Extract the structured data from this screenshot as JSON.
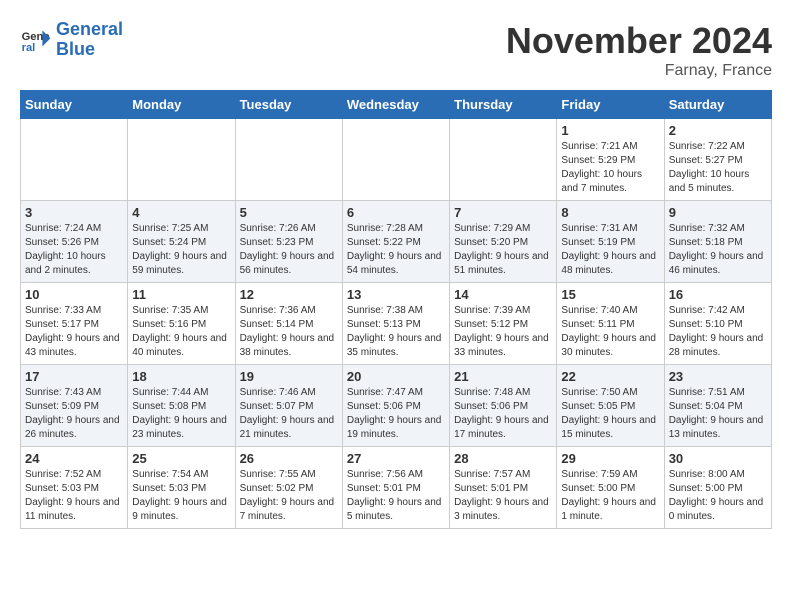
{
  "logo": {
    "line1": "General",
    "line2": "Blue"
  },
  "title": "November 2024",
  "location": "Farnay, France",
  "weekdays": [
    "Sunday",
    "Monday",
    "Tuesday",
    "Wednesday",
    "Thursday",
    "Friday",
    "Saturday"
  ],
  "weeks": [
    [
      {
        "day": "",
        "info": ""
      },
      {
        "day": "",
        "info": ""
      },
      {
        "day": "",
        "info": ""
      },
      {
        "day": "",
        "info": ""
      },
      {
        "day": "",
        "info": ""
      },
      {
        "day": "1",
        "info": "Sunrise: 7:21 AM\nSunset: 5:29 PM\nDaylight: 10 hours\nand 7 minutes."
      },
      {
        "day": "2",
        "info": "Sunrise: 7:22 AM\nSunset: 5:27 PM\nDaylight: 10 hours\nand 5 minutes."
      }
    ],
    [
      {
        "day": "3",
        "info": "Sunrise: 7:24 AM\nSunset: 5:26 PM\nDaylight: 10 hours\nand 2 minutes."
      },
      {
        "day": "4",
        "info": "Sunrise: 7:25 AM\nSunset: 5:24 PM\nDaylight: 9 hours\nand 59 minutes."
      },
      {
        "day": "5",
        "info": "Sunrise: 7:26 AM\nSunset: 5:23 PM\nDaylight: 9 hours\nand 56 minutes."
      },
      {
        "day": "6",
        "info": "Sunrise: 7:28 AM\nSunset: 5:22 PM\nDaylight: 9 hours\nand 54 minutes."
      },
      {
        "day": "7",
        "info": "Sunrise: 7:29 AM\nSunset: 5:20 PM\nDaylight: 9 hours\nand 51 minutes."
      },
      {
        "day": "8",
        "info": "Sunrise: 7:31 AM\nSunset: 5:19 PM\nDaylight: 9 hours\nand 48 minutes."
      },
      {
        "day": "9",
        "info": "Sunrise: 7:32 AM\nSunset: 5:18 PM\nDaylight: 9 hours\nand 46 minutes."
      }
    ],
    [
      {
        "day": "10",
        "info": "Sunrise: 7:33 AM\nSunset: 5:17 PM\nDaylight: 9 hours\nand 43 minutes."
      },
      {
        "day": "11",
        "info": "Sunrise: 7:35 AM\nSunset: 5:16 PM\nDaylight: 9 hours\nand 40 minutes."
      },
      {
        "day": "12",
        "info": "Sunrise: 7:36 AM\nSunset: 5:14 PM\nDaylight: 9 hours\nand 38 minutes."
      },
      {
        "day": "13",
        "info": "Sunrise: 7:38 AM\nSunset: 5:13 PM\nDaylight: 9 hours\nand 35 minutes."
      },
      {
        "day": "14",
        "info": "Sunrise: 7:39 AM\nSunset: 5:12 PM\nDaylight: 9 hours\nand 33 minutes."
      },
      {
        "day": "15",
        "info": "Sunrise: 7:40 AM\nSunset: 5:11 PM\nDaylight: 9 hours\nand 30 minutes."
      },
      {
        "day": "16",
        "info": "Sunrise: 7:42 AM\nSunset: 5:10 PM\nDaylight: 9 hours\nand 28 minutes."
      }
    ],
    [
      {
        "day": "17",
        "info": "Sunrise: 7:43 AM\nSunset: 5:09 PM\nDaylight: 9 hours\nand 26 minutes."
      },
      {
        "day": "18",
        "info": "Sunrise: 7:44 AM\nSunset: 5:08 PM\nDaylight: 9 hours\nand 23 minutes."
      },
      {
        "day": "19",
        "info": "Sunrise: 7:46 AM\nSunset: 5:07 PM\nDaylight: 9 hours\nand 21 minutes."
      },
      {
        "day": "20",
        "info": "Sunrise: 7:47 AM\nSunset: 5:06 PM\nDaylight: 9 hours\nand 19 minutes."
      },
      {
        "day": "21",
        "info": "Sunrise: 7:48 AM\nSunset: 5:06 PM\nDaylight: 9 hours\nand 17 minutes."
      },
      {
        "day": "22",
        "info": "Sunrise: 7:50 AM\nSunset: 5:05 PM\nDaylight: 9 hours\nand 15 minutes."
      },
      {
        "day": "23",
        "info": "Sunrise: 7:51 AM\nSunset: 5:04 PM\nDaylight: 9 hours\nand 13 minutes."
      }
    ],
    [
      {
        "day": "24",
        "info": "Sunrise: 7:52 AM\nSunset: 5:03 PM\nDaylight: 9 hours\nand 11 minutes."
      },
      {
        "day": "25",
        "info": "Sunrise: 7:54 AM\nSunset: 5:03 PM\nDaylight: 9 hours\nand 9 minutes."
      },
      {
        "day": "26",
        "info": "Sunrise: 7:55 AM\nSunset: 5:02 PM\nDaylight: 9 hours\nand 7 minutes."
      },
      {
        "day": "27",
        "info": "Sunrise: 7:56 AM\nSunset: 5:01 PM\nDaylight: 9 hours\nand 5 minutes."
      },
      {
        "day": "28",
        "info": "Sunrise: 7:57 AM\nSunset: 5:01 PM\nDaylight: 9 hours\nand 3 minutes."
      },
      {
        "day": "29",
        "info": "Sunrise: 7:59 AM\nSunset: 5:00 PM\nDaylight: 9 hours\nand 1 minute."
      },
      {
        "day": "30",
        "info": "Sunrise: 8:00 AM\nSunset: 5:00 PM\nDaylight: 9 hours\nand 0 minutes."
      }
    ]
  ]
}
